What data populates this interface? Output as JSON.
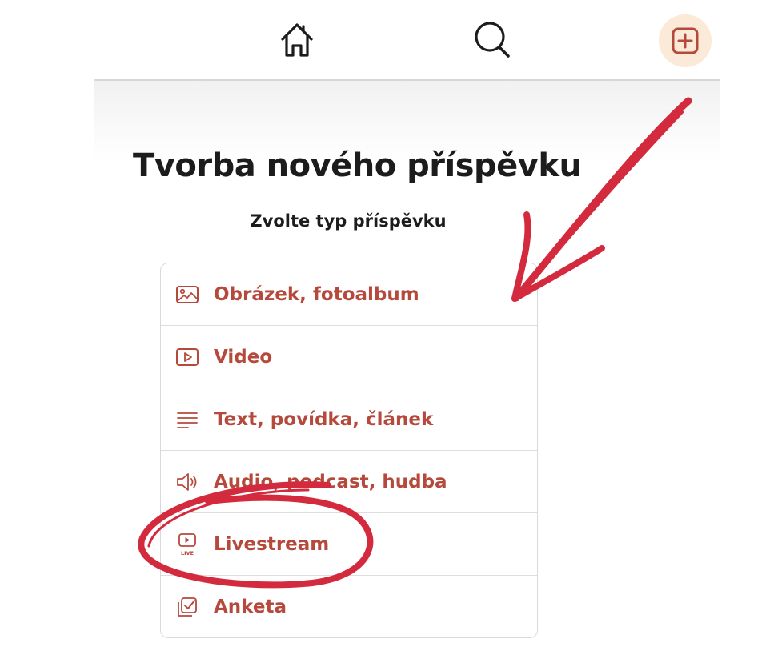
{
  "header": {
    "home_icon": "home-icon",
    "search_icon": "search-icon",
    "add_icon": "plus-square-icon",
    "add_button_bg": "#fbead8"
  },
  "page": {
    "title": "Tvorba nového příspěvku",
    "subtitle": "Zvolte typ příspěvku"
  },
  "post_types": [
    {
      "label": "Obrázek, fotoalbum",
      "icon": "image-icon"
    },
    {
      "label": "Video",
      "icon": "video-play-icon"
    },
    {
      "label": "Text, povídka, článek",
      "icon": "text-lines-icon"
    },
    {
      "label": "Audio, podcast, hudba",
      "icon": "speaker-icon"
    },
    {
      "label": "Livestream",
      "icon": "live-tv-icon",
      "icon_badge": "LIVE"
    },
    {
      "label": "Anketa",
      "icon": "poll-check-icon"
    }
  ],
  "annotations": {
    "color": "#d42a3e",
    "arrow": "hand-drawn arrow from add button to first option",
    "circle": "hand-drawn circle around Livestream"
  },
  "colors": {
    "accent": "#b54a3c",
    "title": "#1c1c1c",
    "border": "#d9d9d9",
    "annotation": "#d42a3e"
  }
}
